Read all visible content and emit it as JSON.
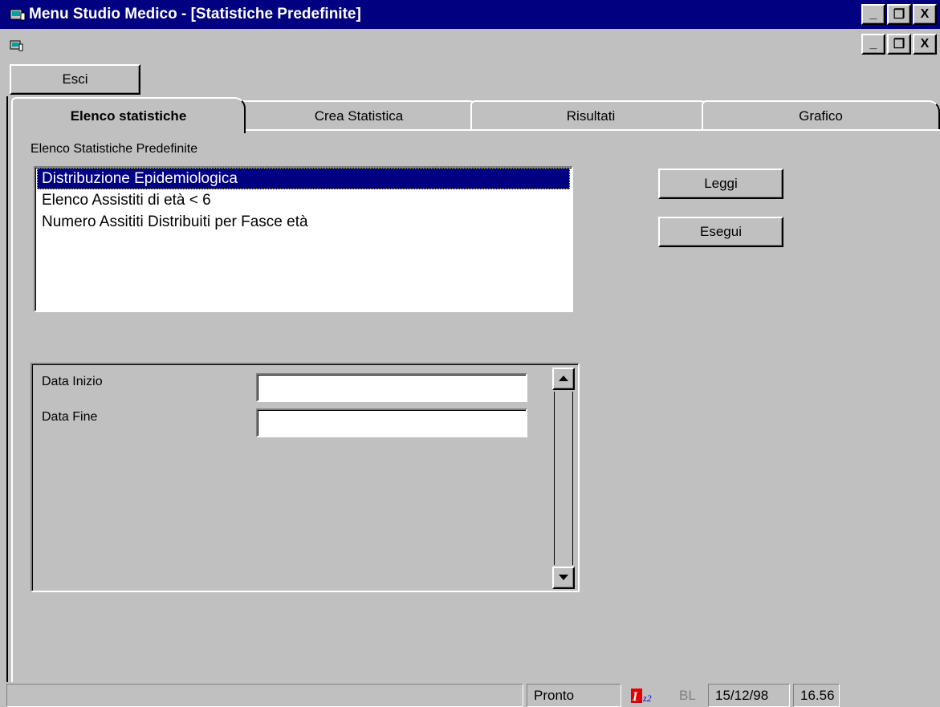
{
  "window": {
    "title": "Menu Studio Medico - [Statistiche Predefinite]",
    "min_label": "_",
    "restore_label": "❐",
    "close_label": "X"
  },
  "toolbar": {
    "esci_label": "Esci"
  },
  "tabs": [
    {
      "label": "Elenco statistiche",
      "active": true
    },
    {
      "label": "Crea Statistica",
      "active": false
    },
    {
      "label": "Risultati",
      "active": false
    },
    {
      "label": "Grafico",
      "active": false
    }
  ],
  "list": {
    "label": "Elenco Statistiche Predefinite",
    "items": [
      {
        "label": "Distribuzione Epidemiologica",
        "selected": true
      },
      {
        "label": "Elenco Assistiti di età < 6",
        "selected": false
      },
      {
        "label": "Numero Assititi Distribuiti per Fasce età",
        "selected": false
      }
    ]
  },
  "actions": {
    "leggi_label": "Leggi",
    "esegui_label": "Esegui"
  },
  "params": {
    "data_inizio_label": "Data Inizio",
    "data_inizio_value": "",
    "data_fine_label": "Data Fine",
    "data_fine_value": ""
  },
  "status": {
    "text": "Pronto",
    "bl": "BL",
    "date": "15/12/98",
    "time": "16.56"
  },
  "colors": {
    "titlebar": "#000080",
    "face": "#c0c0c0",
    "selection": "#000080"
  }
}
